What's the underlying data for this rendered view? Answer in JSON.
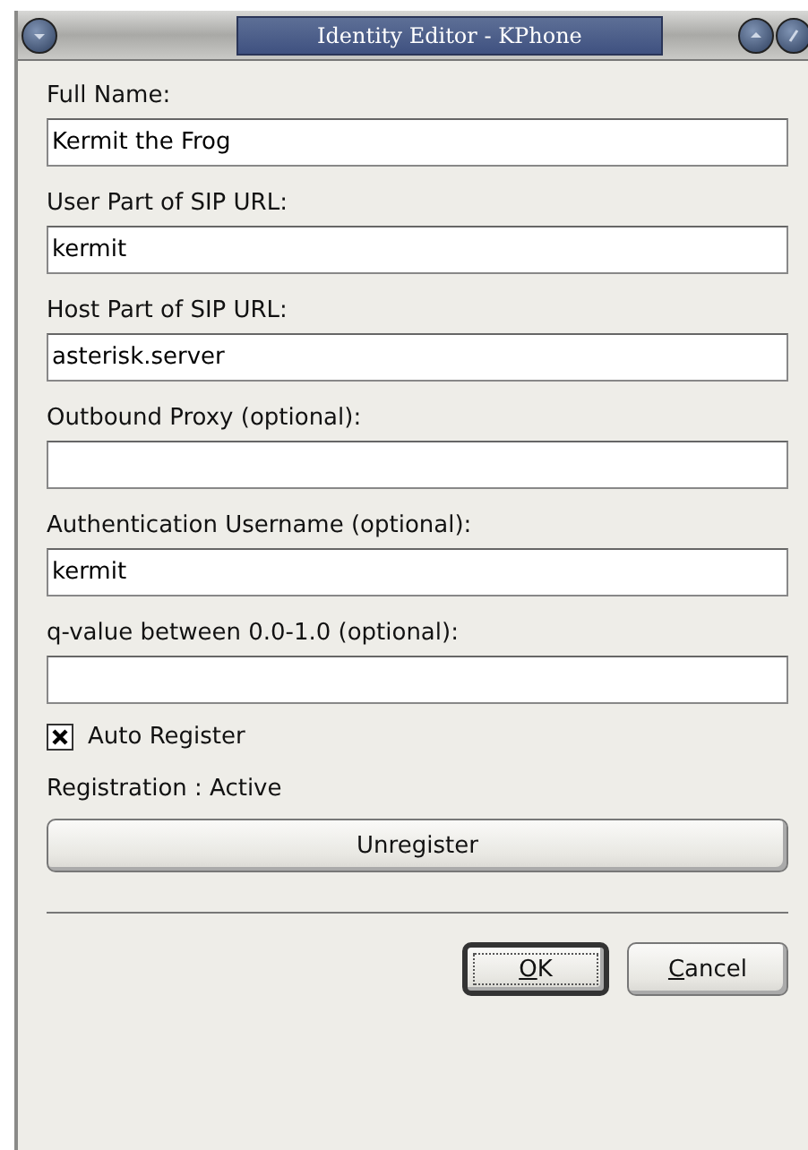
{
  "window": {
    "title": "Identity Editor - KPhone"
  },
  "fields": [
    {
      "label": "Full Name:",
      "value": "Kermit the Frog"
    },
    {
      "label": "User Part of SIP URL:",
      "value": "kermit"
    },
    {
      "label": "Host Part of SIP URL:",
      "value": "asterisk.server"
    },
    {
      "label": "Outbound Proxy (optional):"
    },
    {
      "label": "Authentication Username (optional):",
      "value": "kermit"
    },
    {
      "label": "q-value between 0.0-1.0 (optional):"
    }
  ],
  "auto_register": {
    "label": "Auto Register",
    "checked": true
  },
  "registration_status": "Registration : Active",
  "unregister_button": "Unregister",
  "buttons": [
    {
      "mnemonic": "O",
      "rest": "K",
      "default": true
    },
    {
      "mnemonic": "C",
      "rest": "ancel",
      "default": false
    }
  ]
}
